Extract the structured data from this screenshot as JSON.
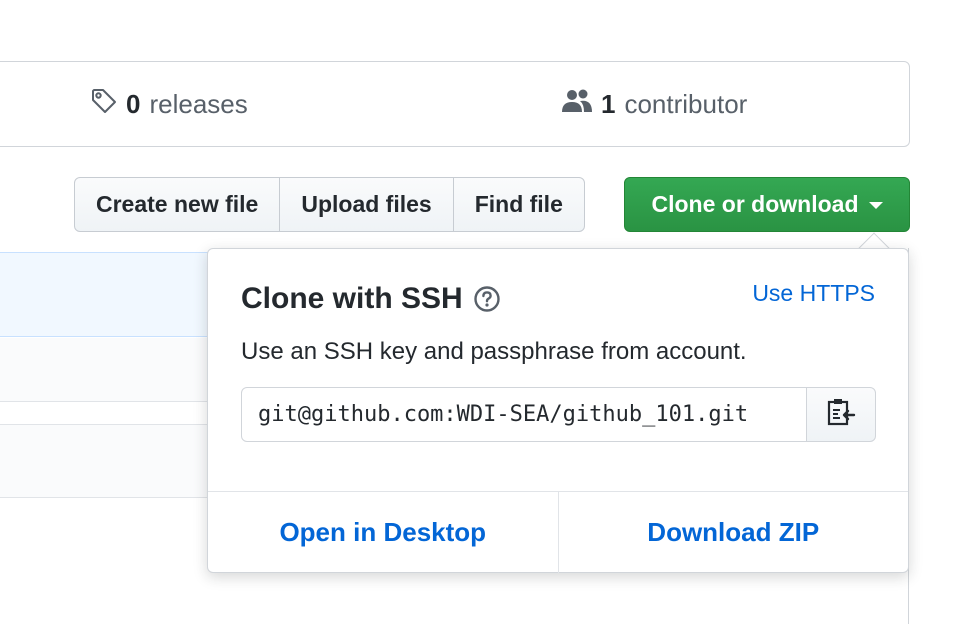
{
  "summary": {
    "releases": {
      "count": "0",
      "label": "releases",
      "icon": "tag-icon"
    },
    "contributors": {
      "count": "1",
      "label": "contributor",
      "icon": "people-icon"
    }
  },
  "toolbar": {
    "create_label": "Create new file",
    "upload_label": "Upload files",
    "find_label": "Find file",
    "clone_label": "Clone or download"
  },
  "clone_popover": {
    "title": "Clone with SSH",
    "help_icon": "question-icon",
    "switch_label": "Use HTTPS",
    "description": "Use an SSH key and passphrase from account.",
    "url": "git@github.com:WDI-SEA/github_101.git",
    "copy_icon": "clippy-icon",
    "open_desktop_label": "Open in Desktop",
    "download_zip_label": "Download ZIP"
  },
  "colors": {
    "primary_green": "#2ea44f",
    "link_blue": "#0366d6",
    "border": "#d1d5da"
  }
}
